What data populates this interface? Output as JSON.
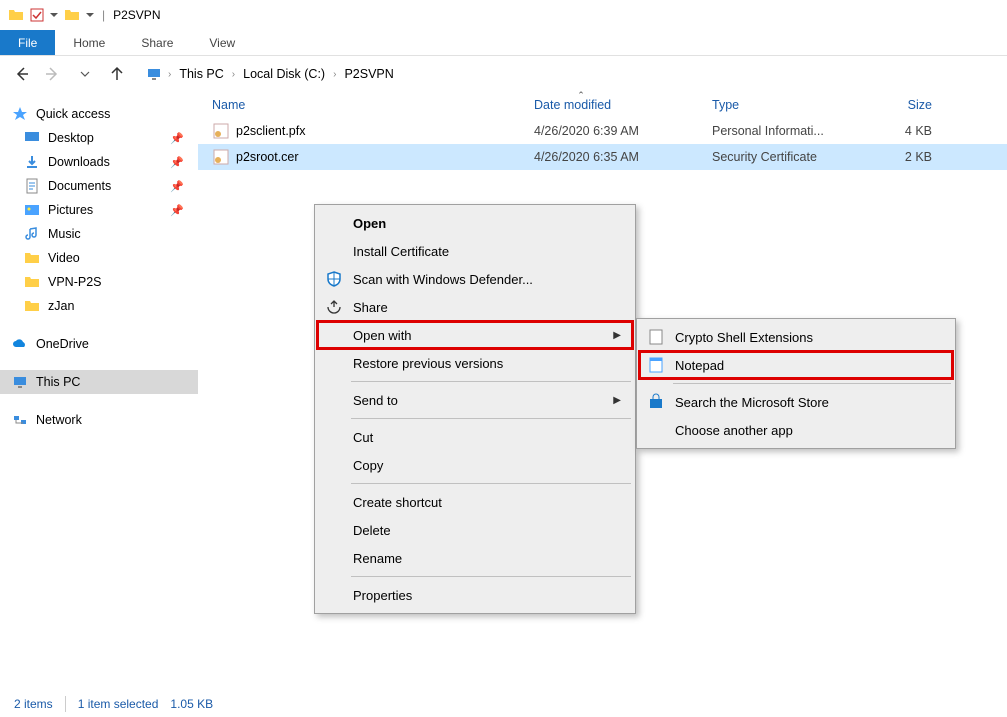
{
  "window": {
    "title": "P2SVPN"
  },
  "ribbon": {
    "file": "File",
    "tabs": [
      "Home",
      "Share",
      "View"
    ]
  },
  "breadcrumb": [
    "This PC",
    "Local Disk (C:)",
    "P2SVPN"
  ],
  "columns": {
    "name": "Name",
    "date": "Date modified",
    "type": "Type",
    "size": "Size"
  },
  "files": [
    {
      "name": "p2sclient.pfx",
      "date": "4/26/2020 6:39 AM",
      "type": "Personal Informati...",
      "size": "4 KB"
    },
    {
      "name": "p2sroot.cer",
      "date": "4/26/2020 6:35 AM",
      "type": "Security Certificate",
      "size": "2 KB"
    }
  ],
  "sidebar": {
    "quick_access": "Quick access",
    "quick_items": [
      "Desktop",
      "Downloads",
      "Documents",
      "Pictures",
      "Music",
      "Video",
      "VPN-P2S",
      "zJan"
    ],
    "onedrive": "OneDrive",
    "this_pc": "This PC",
    "network": "Network"
  },
  "context_menu": {
    "open": "Open",
    "install": "Install Certificate",
    "scan": "Scan with Windows Defender...",
    "share": "Share",
    "open_with": "Open with",
    "restore": "Restore previous versions",
    "send_to": "Send to",
    "cut": "Cut",
    "copy": "Copy",
    "shortcut": "Create shortcut",
    "delete": "Delete",
    "rename": "Rename",
    "properties": "Properties"
  },
  "submenu": {
    "crypto": "Crypto Shell Extensions",
    "notepad": "Notepad",
    "store": "Search the Microsoft Store",
    "choose": "Choose another app"
  },
  "status": {
    "items": "2 items",
    "selected": "1 item selected",
    "size": "1.05 KB"
  }
}
